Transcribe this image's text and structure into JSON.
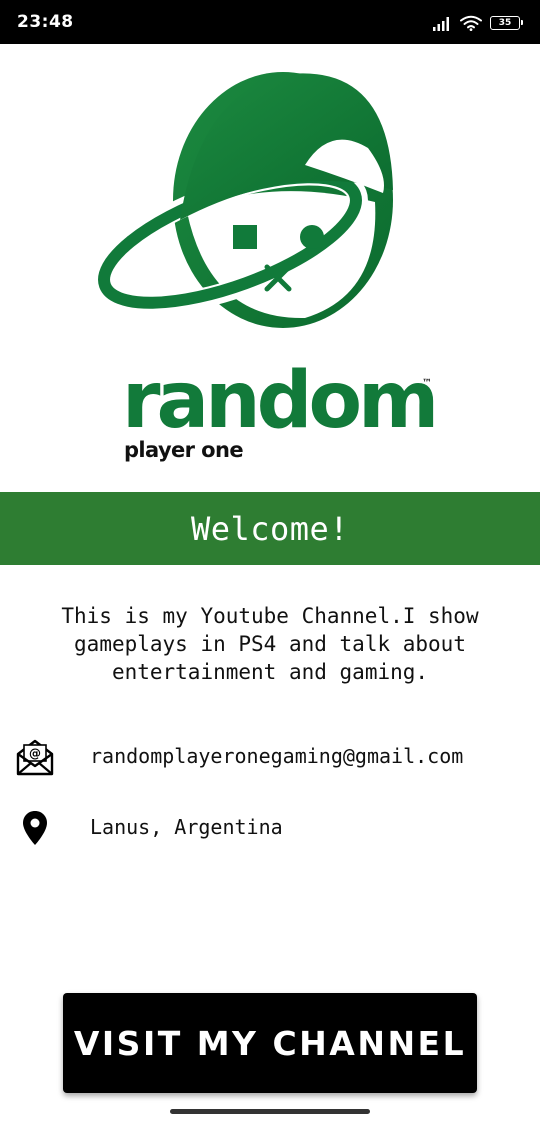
{
  "status_bar": {
    "time": "23:48",
    "battery_level": "35",
    "icons": [
      "signal-icon",
      "wifi-icon",
      "battery-icon"
    ]
  },
  "logo": {
    "wordmark": "random",
    "trademark": "™",
    "subtitle": "player one",
    "brand_color": "#127a3a"
  },
  "welcome": {
    "text": "Welcome!",
    "background_color": "#2e7d32"
  },
  "description": {
    "lines": [
      "This is my Youtube Channel.I show",
      "gameplays in PS4 and talk about",
      "entertainment and gaming."
    ]
  },
  "contact": {
    "email": {
      "icon": "email-icon",
      "value": "randomplayeronegaming@gmail.com"
    },
    "location": {
      "icon": "location-pin-icon",
      "value": "Lanus, Argentina"
    }
  },
  "cta": {
    "label": "VISIT MY CHANNEL"
  }
}
